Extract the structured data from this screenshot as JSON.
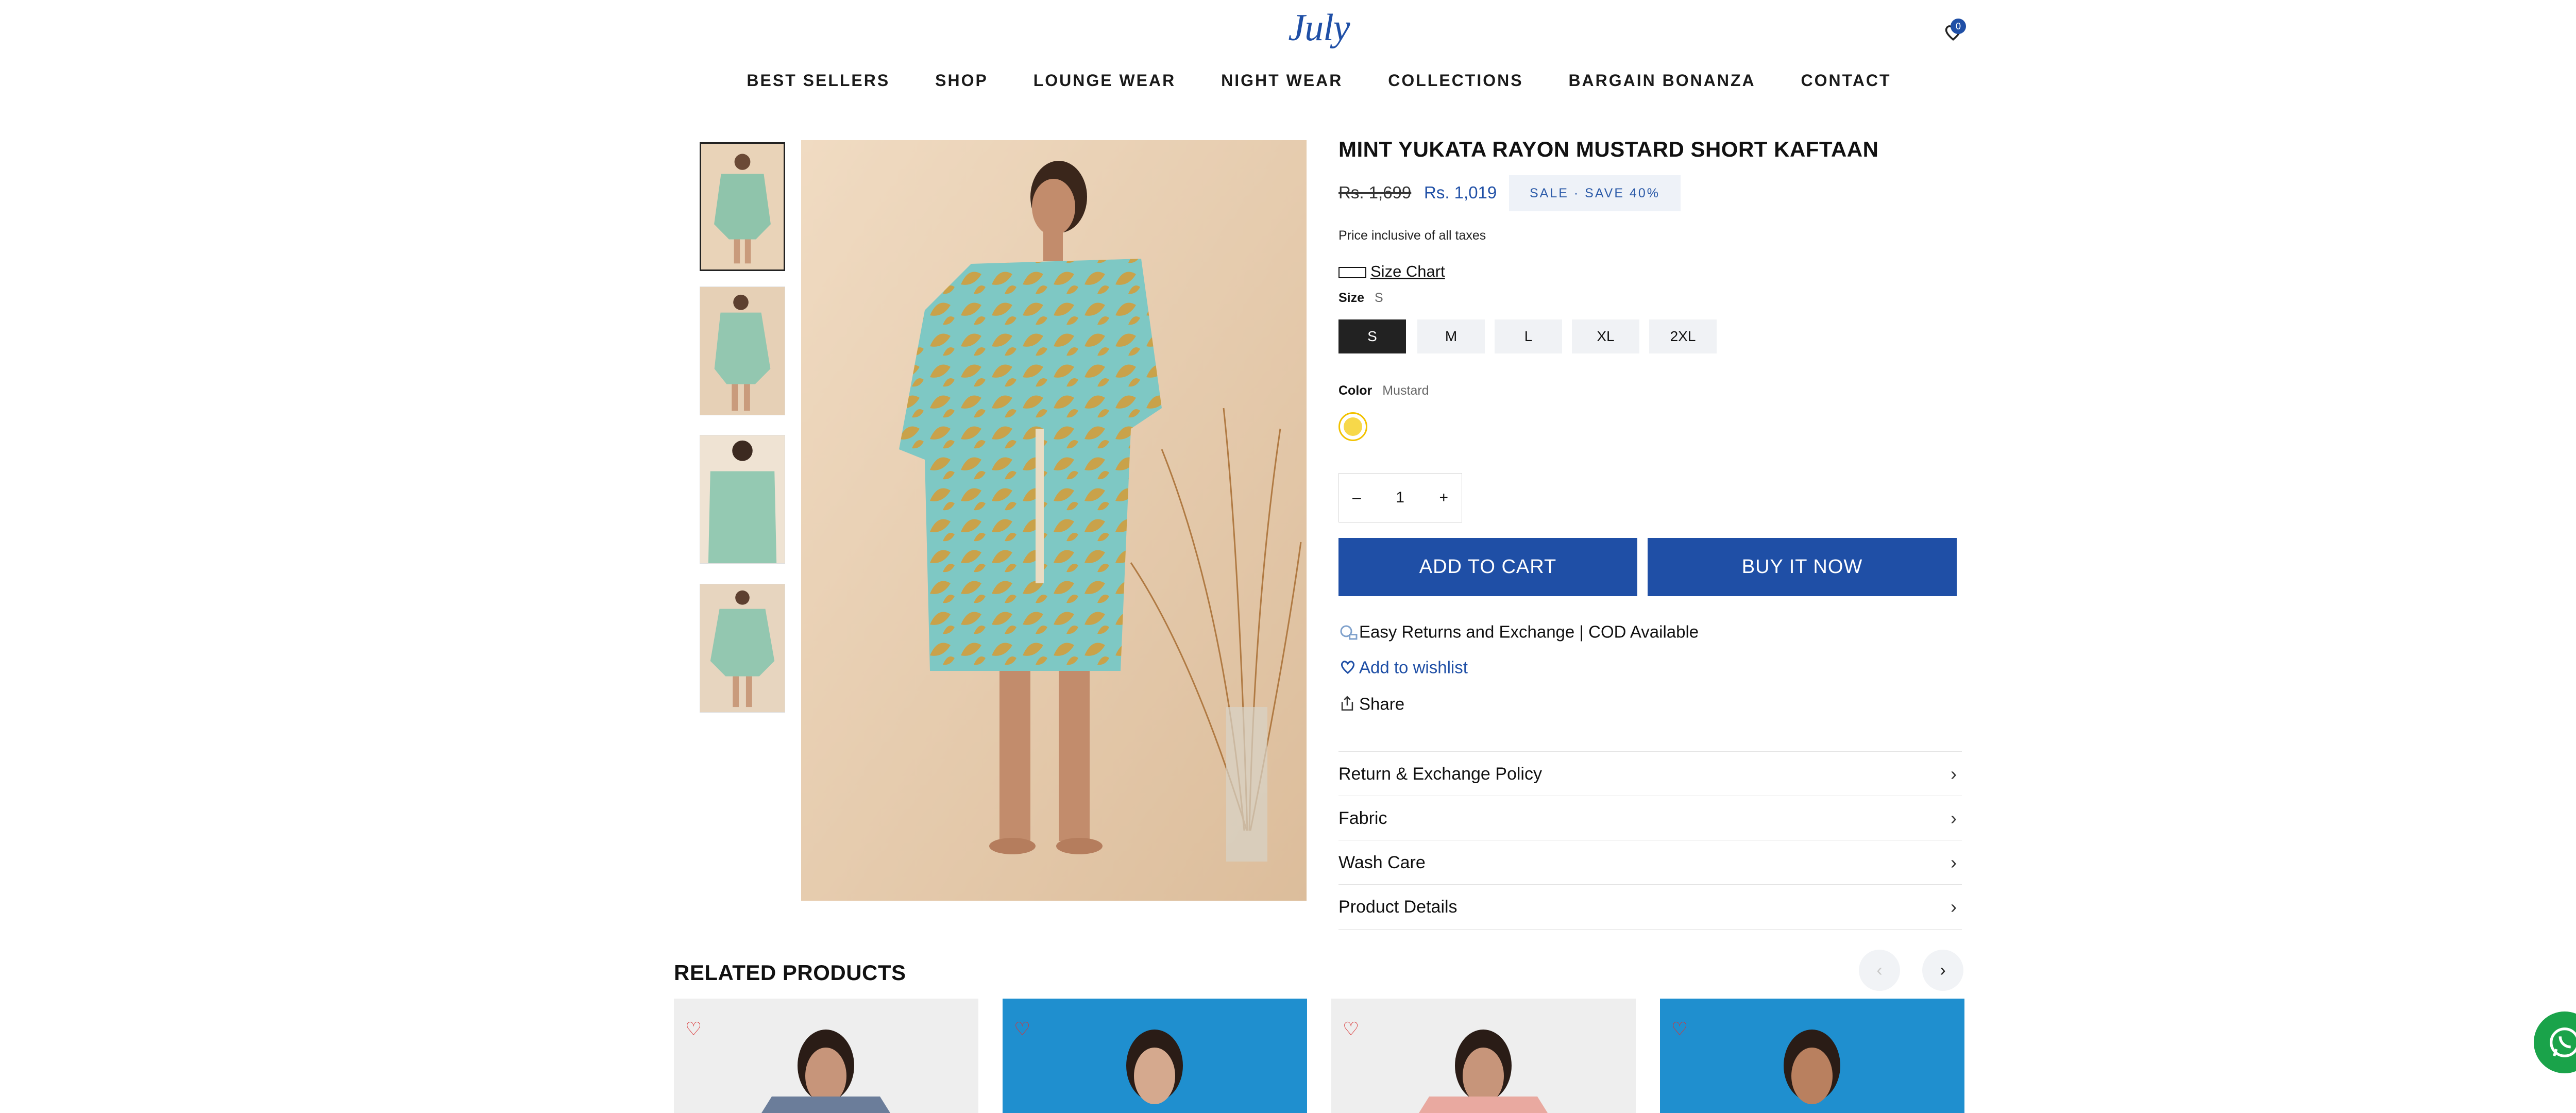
{
  "header": {
    "logo": "July",
    "cart_count": "0",
    "nav": [
      "BEST SELLERS",
      "SHOP",
      "LOUNGE WEAR",
      "NIGHT WEAR",
      "COLLECTIONS",
      "BARGAIN BONANZA",
      "CONTACT"
    ]
  },
  "product": {
    "title": "MINT YUKATA RAYON MUSTARD SHORT KAFTAAN",
    "price_old": "Rs. 1,699",
    "price_new": "Rs. 1,019",
    "sale_label": "SALE · SAVE 40%",
    "tax_note": "Price inclusive of all taxes",
    "size_chart": "Size Chart",
    "size_label": "Size",
    "size_selected": "S",
    "sizes": [
      "S",
      "M",
      "L",
      "XL",
      "2XL"
    ],
    "color_label": "Color",
    "color_selected": "Mustard",
    "quantity": "1",
    "qty_minus": "–",
    "qty_plus": "+",
    "add_to_cart": "ADD TO CART",
    "buy_now": "BUY IT NOW",
    "returns_note": "Easy Returns and Exchange | COD Available",
    "wishlist": "Add to wishlist",
    "share": "Share",
    "accordions": [
      "Return & Exchange Policy",
      "Fabric",
      "Wash Care",
      "Product Details"
    ]
  },
  "related": {
    "title": "RELATED PRODUCTS",
    "prev": "‹",
    "next": "›"
  },
  "colors": {
    "brand": "#1f4fa6",
    "swatch": "#f7d84a"
  }
}
